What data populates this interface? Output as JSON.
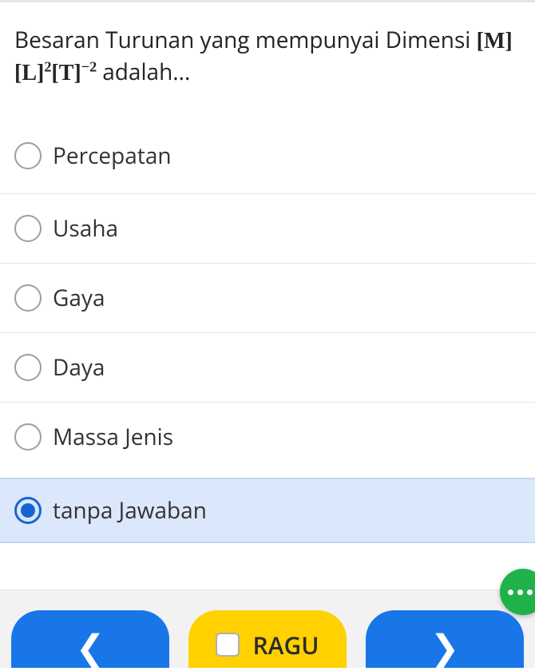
{
  "question": {
    "intro": "Besaran Turunan yang mempunyai Dimensi",
    "tail": "adalah..."
  },
  "options": [
    {
      "label": "Percepatan",
      "selected": false
    },
    {
      "label": "Usaha",
      "selected": false
    },
    {
      "label": "Gaya",
      "selected": false
    },
    {
      "label": "Daya",
      "selected": false
    },
    {
      "label": "Massa Jenis",
      "selected": false
    }
  ],
  "no_answer": {
    "label": "tanpa Jawaban",
    "selected": true
  },
  "nav": {
    "prev_glyph": "❮",
    "next_glyph": "❯",
    "doubt_label": "RAGU"
  }
}
